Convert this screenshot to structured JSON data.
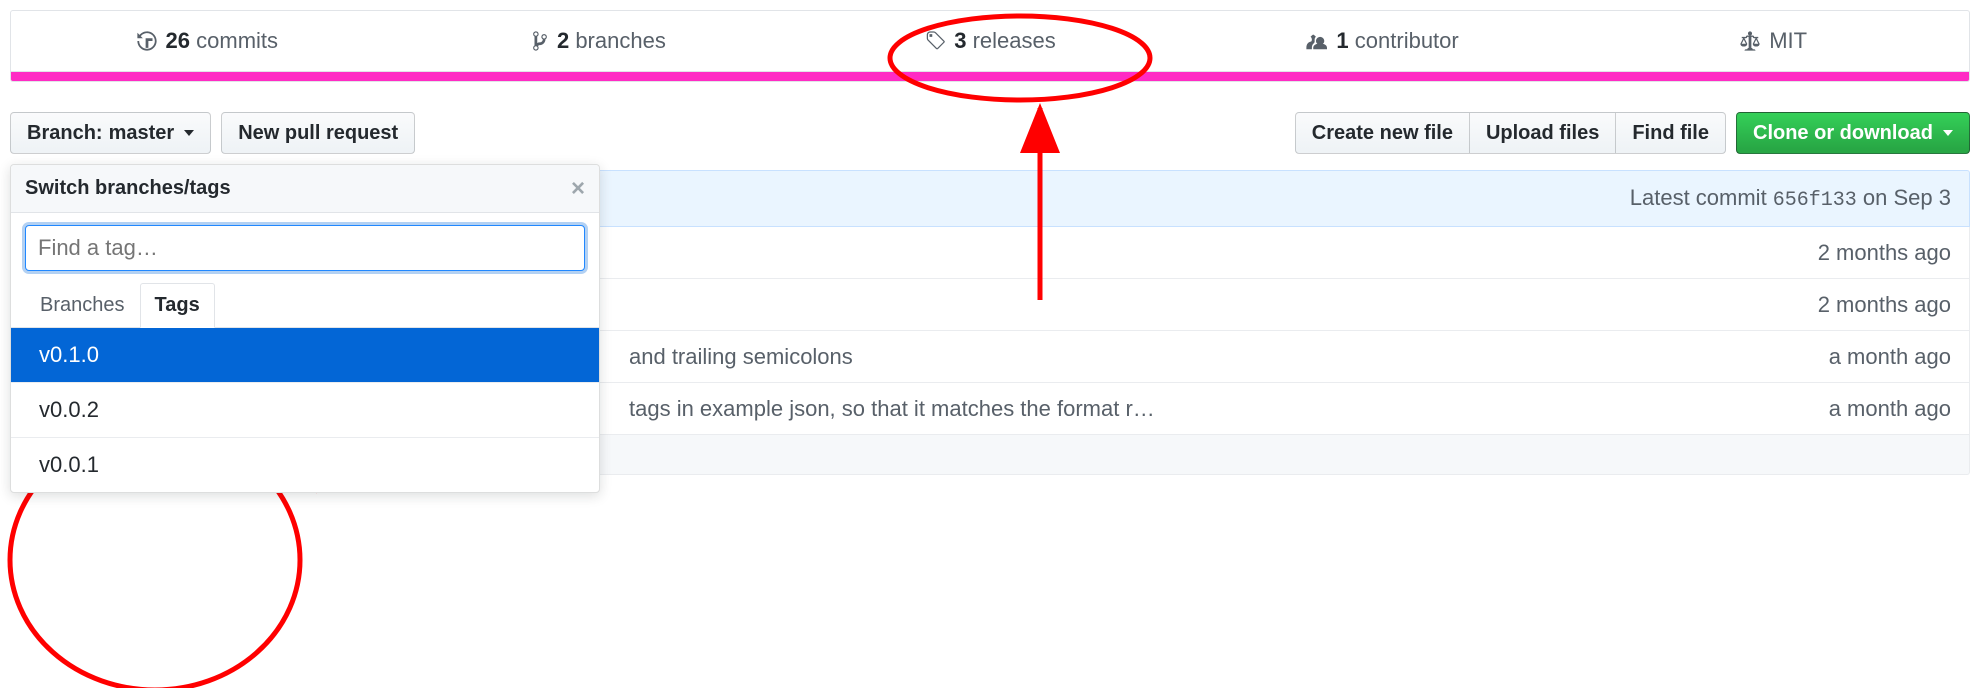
{
  "stats": {
    "commits_count": "26",
    "commits_label": "commits",
    "branches_count": "2",
    "branches_label": "branches",
    "releases_count": "3",
    "releases_label": "releases",
    "contributors_count": "1",
    "contributors_label": "contributor",
    "license_label": "MIT"
  },
  "toolbar": {
    "branch_prefix": "Branch:",
    "branch_name": "master",
    "new_pr_label": "New pull request",
    "create_file_label": "Create new file",
    "upload_label": "Upload files",
    "find_label": "Find file",
    "clone_label": "Clone or download"
  },
  "dropdown": {
    "title": "Switch branches/tags",
    "search_placeholder": "Find a tag…",
    "tab_branches": "Branches",
    "tab_tags": "Tags",
    "items": {
      "0": "v0.1.0",
      "1": "v0.0.2",
      "2": "v0.0.1"
    }
  },
  "commit": {
    "partial_message": "semicolons",
    "latest_label": "Latest commit ",
    "sha": "656f133",
    "date": " on Sep 3"
  },
  "rows": {
    "0": {
      "msg": "",
      "time": "2 months ago"
    },
    "1": {
      "msg": "",
      "time": "2 months ago"
    },
    "2": {
      "msg": " and trailing semicolons",
      "time": "a month ago"
    },
    "3": {
      "msg": "tags in example json, so that it matches the format r…",
      "time": "a month ago"
    }
  }
}
